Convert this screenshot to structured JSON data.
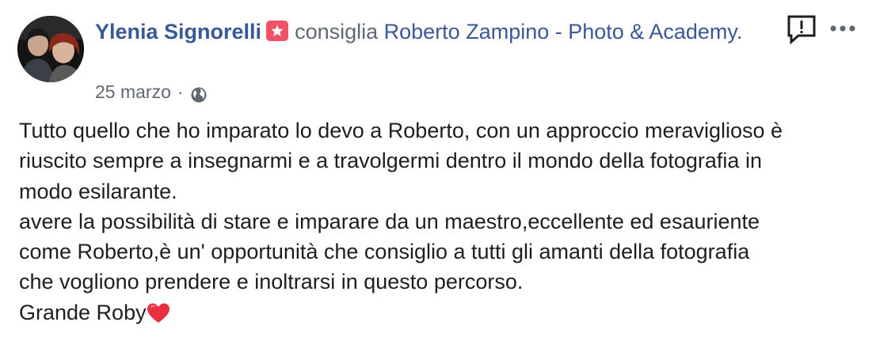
{
  "post": {
    "author": "Ylenia Signorelli",
    "verb": "consiglia",
    "page": "Roberto Zampino - Photo & Academy.",
    "date": "25 marzo",
    "separator": "·",
    "body_lines": [
      "Tutto quello che ho imparato lo devo a Roberto, con un approccio meraviglioso è",
      "riuscito sempre a insegnarmi e a travolgermi dentro il mondo della fotografia in",
      "modo esilarante.",
      "avere la possibilità di stare e imparare da un maestro,eccellente ed esauriente",
      "come Roberto,è un' opportunità che consiglio a tutti gli amanti della fotografia",
      "che vogliono prendere e inoltrarsi in questo percorso.",
      "Grande Roby"
    ],
    "icons": {
      "recommend_badge": "star-badge-icon",
      "privacy": "globe-icon",
      "report": "report-icon",
      "more": "more-options-icon",
      "heart": "red-heart-icon"
    },
    "colors": {
      "link": "#385898",
      "meta": "#606770",
      "text": "#1c1e21",
      "badge": "#f25268",
      "heart": "#e8303f"
    }
  }
}
